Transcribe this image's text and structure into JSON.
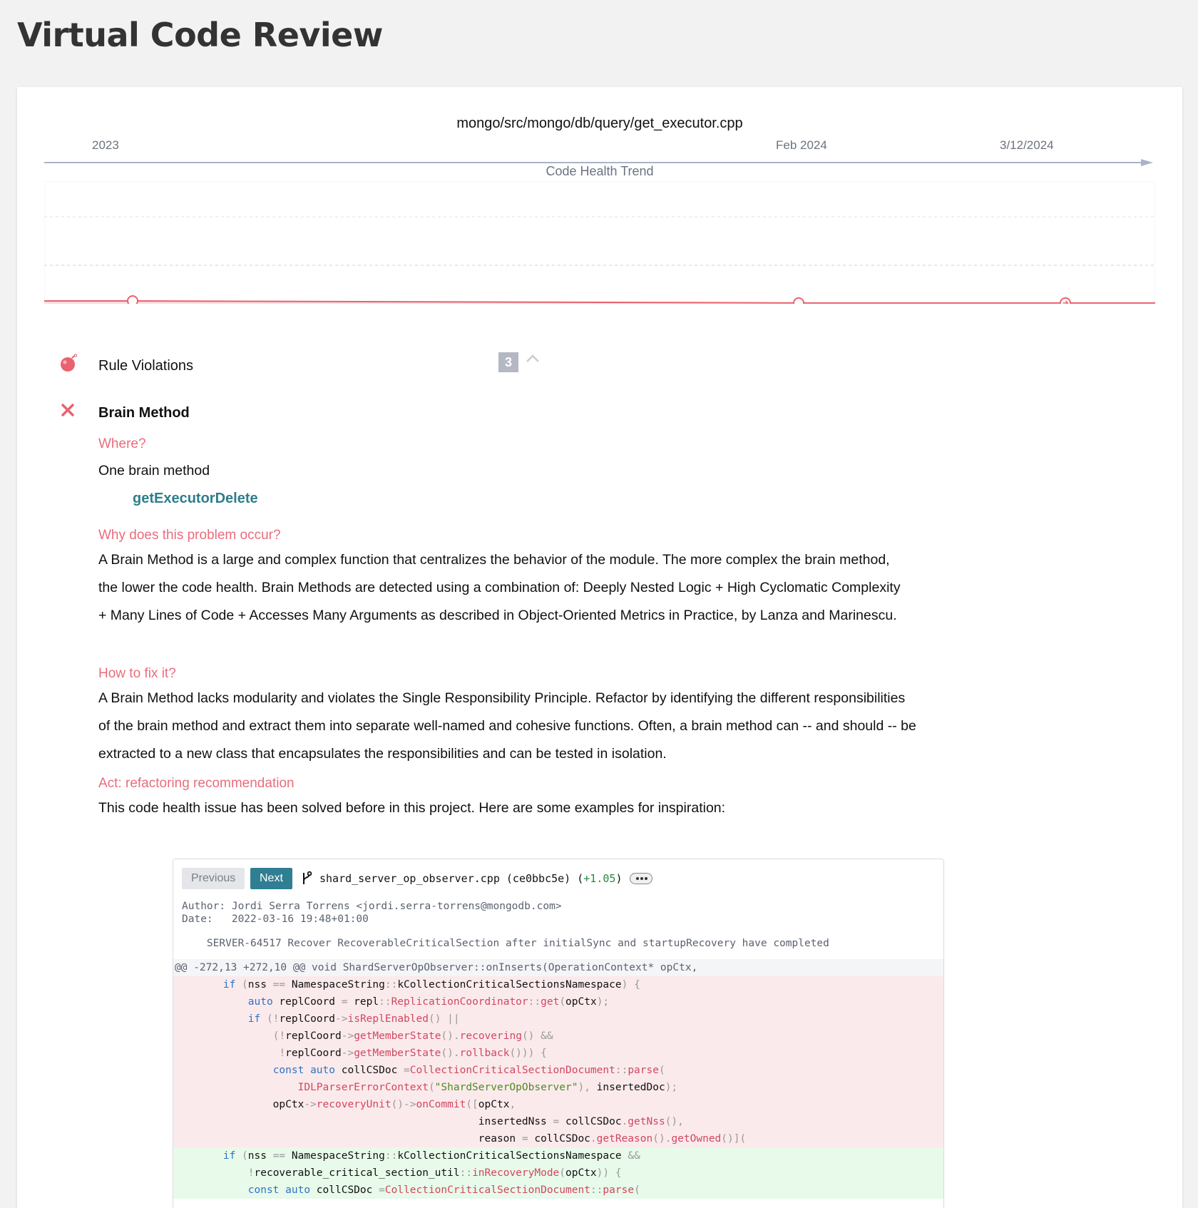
{
  "page_title": "Virtual Code Review",
  "file_path": "mongo/src/mongo/db/query/get_executor.cpp",
  "timeline": {
    "labels": [
      "2023",
      "Feb 2024",
      "3/12/2024"
    ]
  },
  "trend": {
    "title": "Code Health Trend",
    "points": [
      {
        "date": "2023",
        "health": 2.72
      },
      {
        "date": "Feb 2024",
        "health": 2.61
      },
      {
        "date": "3/12/2024",
        "health": 2.61
      }
    ],
    "ylim": [
      1,
      10
    ],
    "colors": {
      "line": "#e8636f",
      "fill": "#f8dde0",
      "grid": "#e2e2e2"
    }
  },
  "rule_violations": {
    "label": "Rule Violations",
    "count": "3",
    "icon": "bomb-icon",
    "collapse_icon": "chevron-up-icon"
  },
  "violation": {
    "title": "Brain Method",
    "icon": "close-icon",
    "where_heading": "Where?",
    "where_text": "One brain method",
    "method_name": "getExecutorDelete",
    "why_heading": "Why does this problem occur?",
    "why_text": "A Brain Method is a large and complex function that centralizes the behavior of the module. The more complex the brain method, the lower the code health. Brain Methods are detected using a combination of: Deeply Nested Logic + High Cyclomatic Complexity + Many Lines of Code + Accesses Many Arguments as described in Object-Oriented Metrics in Practice, by Lanza and Marinescu.",
    "fix_heading": "How to fix it?",
    "fix_text": "A Brain Method lacks modularity and violates the Single Responsibility Principle. Refactor by identifying the different responsibilities of the brain method and extract them into separate well-named and cohesive functions. Often, a brain method can -- and should -- be extracted to a new class that encapsulates the responsibilities and can be tested in isolation.",
    "act_heading": "Act: refactoring recommendation",
    "act_text": "This code health issue has been solved before in this project. Here are some examples for inspiration:"
  },
  "diff": {
    "prev_label": "Previous",
    "next_label": "Next",
    "file": "shard_server_op_observer.cpp",
    "commit": "(ce0bbc5e)",
    "gain": "+1.05",
    "author": "Author: Jordi Serra Torrens <jordi.serra-torrens@mongodb.com>",
    "date": "Date:   2022-03-16 19:48+01:00",
    "message": "    SERVER-64517 Recover RecoverableCriticalSection after initialSync and startupRecovery have completed",
    "hunk": "@@ -272,13 +272,10 @@ void ShardServerOpObserver::onInserts(OperationContext* opCtx,"
  },
  "colors": {
    "accent": "#e96d7d",
    "link": "#2e7d8c",
    "next_button": "#2f7e92",
    "removed_bg": "#fbeaec",
    "added_bg": "#e8faea"
  }
}
